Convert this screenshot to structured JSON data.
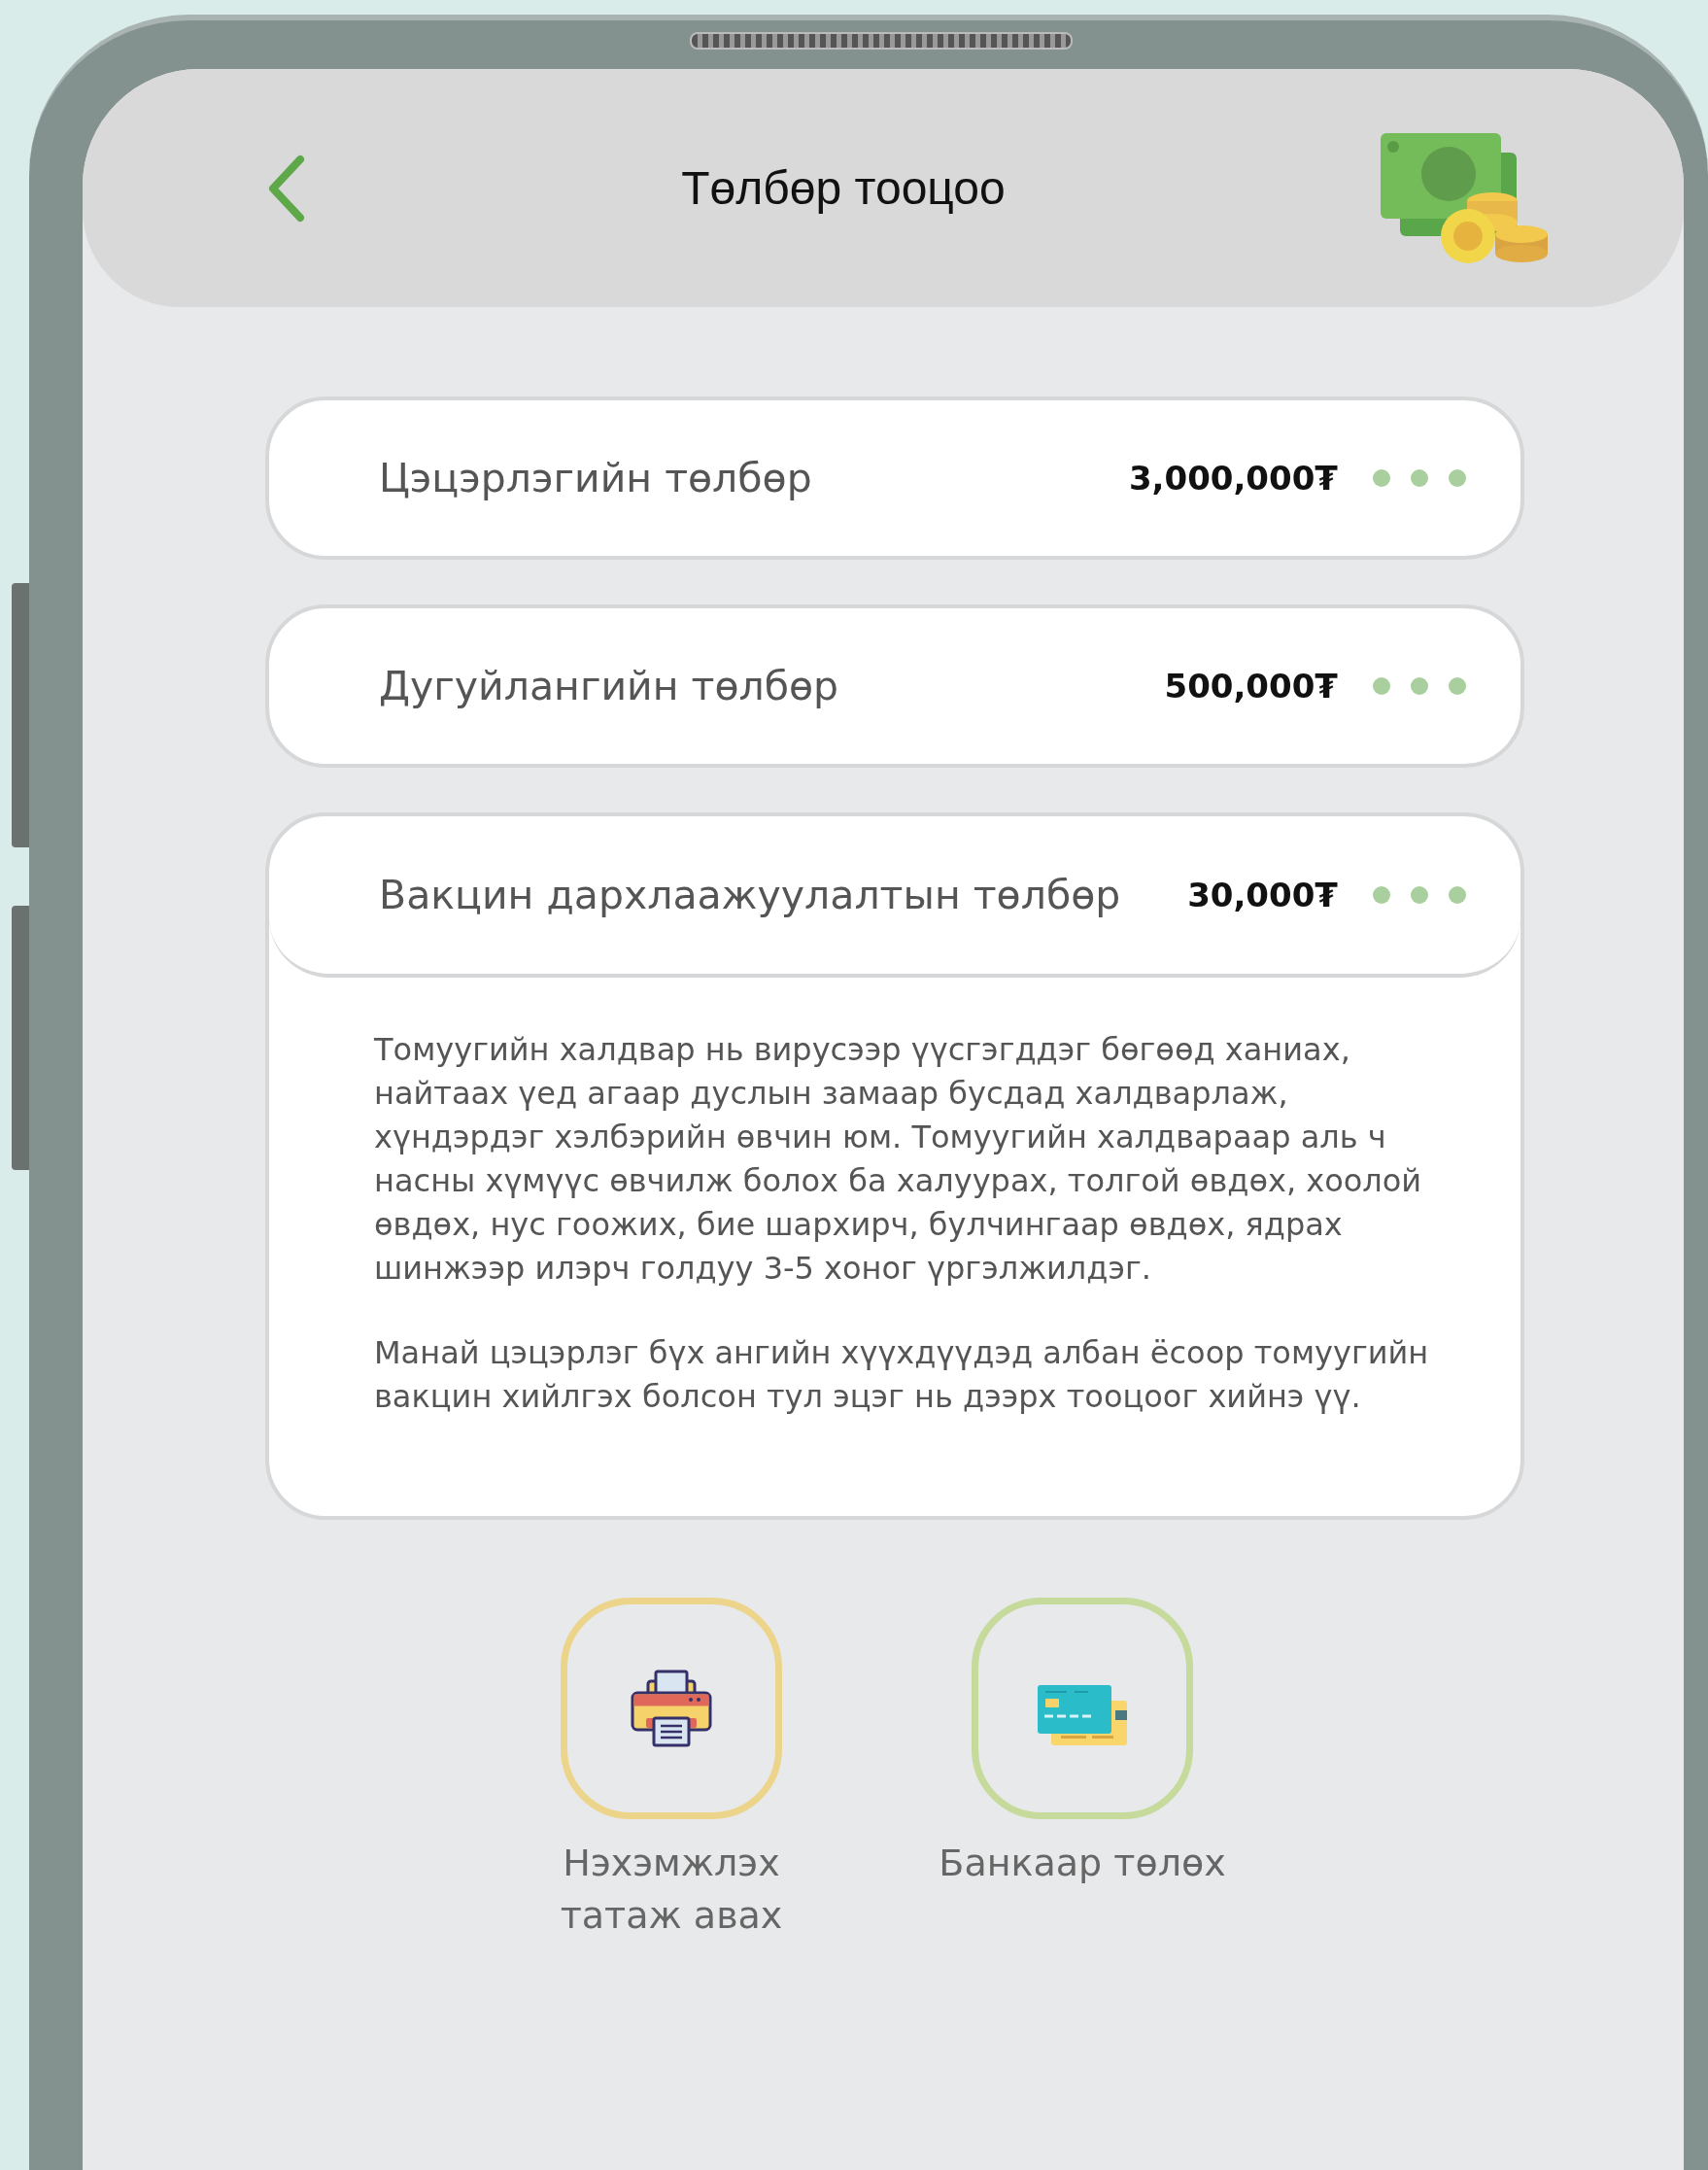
{
  "header": {
    "title": "Төлбөр тооцоо"
  },
  "payments": [
    {
      "name": "Цэцэрлэгийн төлбөр",
      "amount": "3,000,000₮",
      "expanded": false
    },
    {
      "name": "Дугуйлангийн төлбөр",
      "amount": "500,000₮",
      "expanded": false
    },
    {
      "name": "Вакцин дархлаажуулалтын төлбөр",
      "amount": "30,000₮",
      "expanded": true,
      "details": [
        "Томуугийн халдвар нь вирусээр үүсгэгддэг бөгөөд ханиах, найтаах үед агаар дуслын замаар бусдад халдварлаж, хүндэрдэг хэлбэрийн өвчин юм. Томуугийн халдвараар аль ч насны хүмүүс өвчилж болох ба халуурах, толгой өвдөх, хоолой өвдөх, нус гоожих, бие шархирч, булчингаар өвдөх, ядрах шинжээр илэрч голдуу 3-5 хоног үргэлжилдэг.",
        "Манай цэцэрлэг бүх ангийн хүүхдүүдэд албан ёсоор томуугийн вакцин хийлгэх болсон тул эцэг нь дээрх тооцоог хийнэ үү."
      ]
    }
  ],
  "actions": [
    {
      "kind": "print",
      "label": "Нэхэмжлэх татаж авах",
      "color": "#ecd58a"
    },
    {
      "kind": "bank",
      "label": "Банкаар төлөх",
      "color": "#c6da9b"
    }
  ]
}
